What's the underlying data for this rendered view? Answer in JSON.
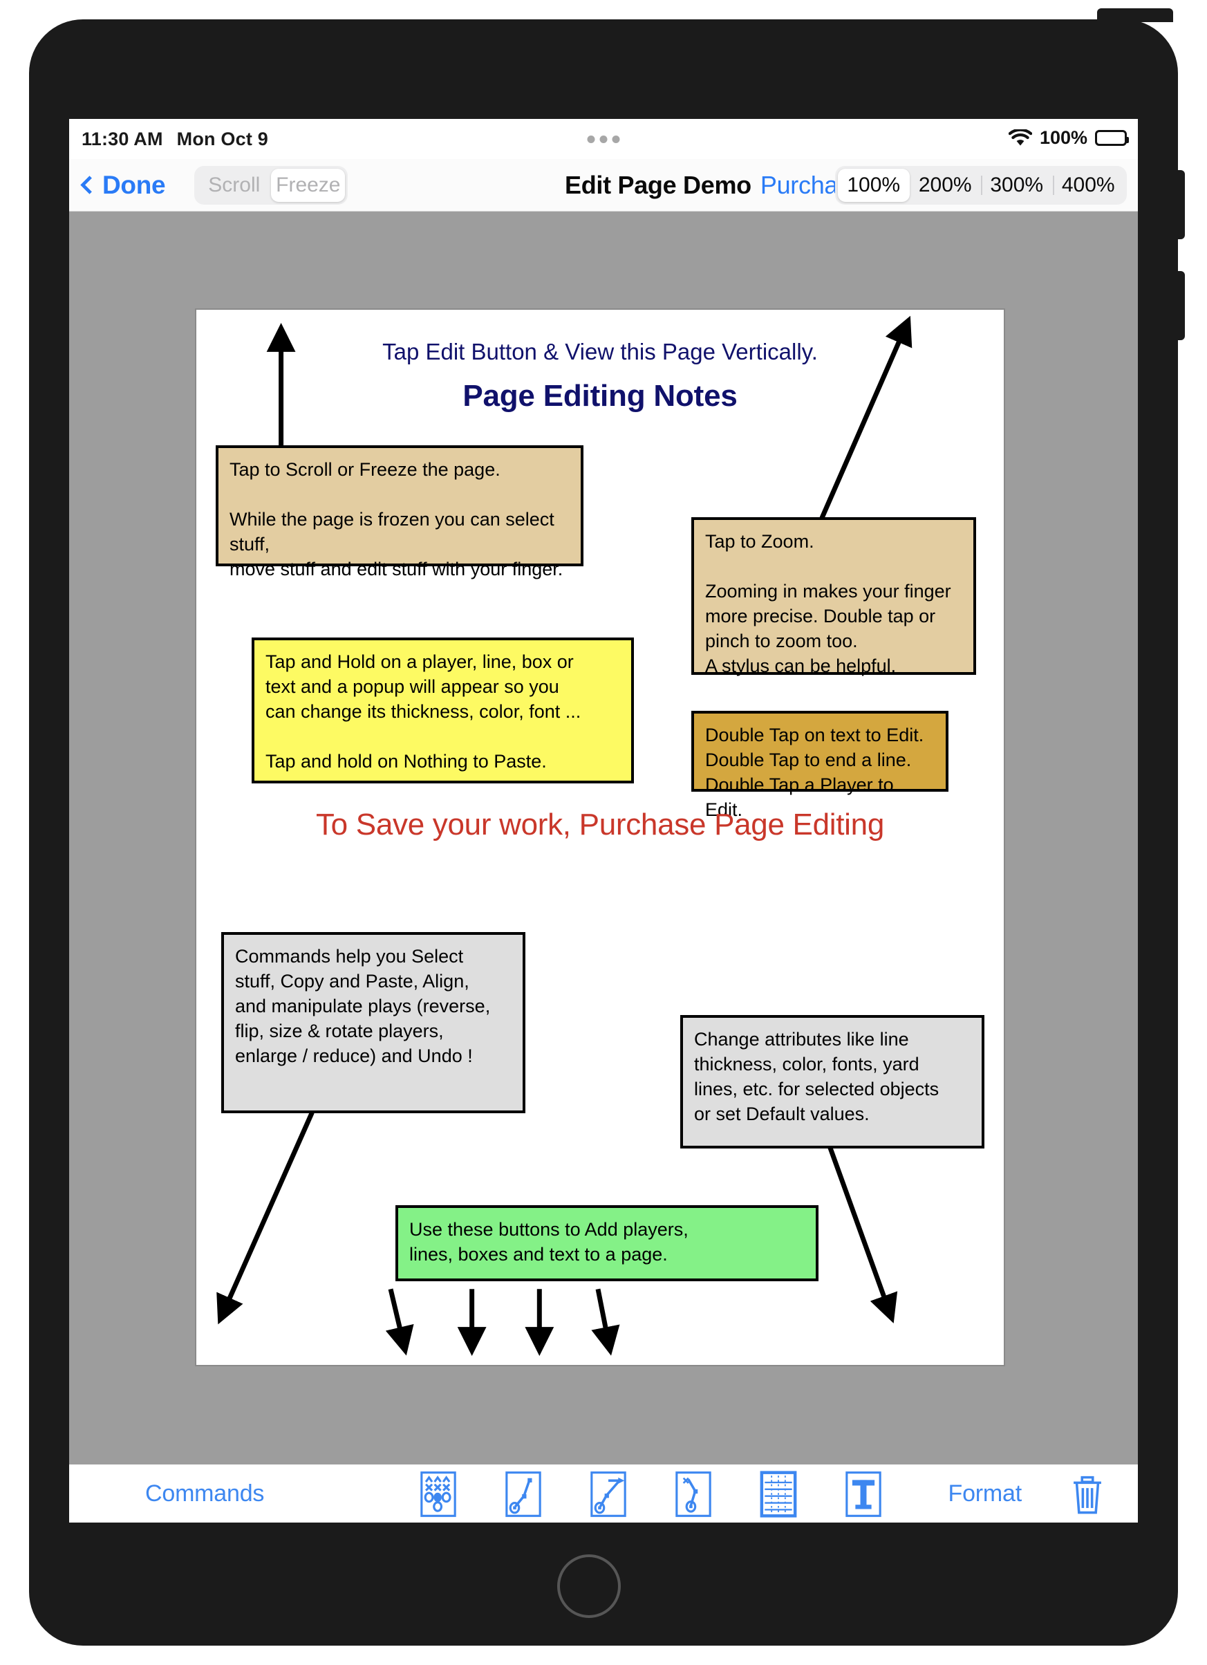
{
  "status_bar": {
    "time": "11:30 AM",
    "date": "Mon Oct 9",
    "wifi_icon": "wifi-icon",
    "battery_percent": "100%",
    "battery_icon": "battery-full-icon",
    "dots_icon": "multitask-dots-icon"
  },
  "nav_bar": {
    "back_icon": "chevron-left-icon",
    "back_label": "Done",
    "mode_segmented": {
      "options": [
        "Scroll",
        "Freeze"
      ],
      "selected": "Freeze"
    },
    "title": "Edit Page Demo",
    "purchase_link": "Purchase",
    "zoom_segmented": {
      "options": [
        "100%",
        "200%",
        "300%",
        "400%"
      ],
      "selected": "100%"
    }
  },
  "page": {
    "subtitle": "Tap Edit Button & View this Page Vertically.",
    "title": "Page Editing Notes",
    "red_callout": "To Save your work, Purchase Page Editing",
    "notes": {
      "scroll_freeze": "Tap to Scroll or Freeze the page.\n\nWhile the page is frozen you can select stuff,\nmove stuff and edit stuff with your finger.",
      "zoom": "Tap to Zoom.\n\nZooming in makes your finger\nmore precise.  Double tap or\npinch to zoom too.\nA stylus can be helpful.",
      "tap_hold": "Tap and Hold on a player, line, box or\ntext and a popup will appear so you\ncan change its thickness, color, font ...\n\nTap and hold on Nothing to Paste.",
      "double_tap": "Double Tap on text to Edit.\nDouble Tap to end a line.\nDouble Tap a Player to Edit.",
      "commands": "Commands help you Select\nstuff, Copy and Paste, Align,\nand manipulate plays (reverse,\nflip, size & rotate players,\nenlarge / reduce) and Undo !",
      "attributes": "Change attributes like line\nthickness, color, fonts, yard\nlines, etc. for selected objects\n or set Default values.",
      "add_buttons": "Use these buttons to Add players,\nlines, boxes and text to a page."
    }
  },
  "toolbar": {
    "commands_label": "Commands",
    "format_label": "Format",
    "icons": [
      "add-players-formation-icon",
      "add-route-line-icon",
      "add-arrow-line-icon",
      "add-block-line-icon",
      "add-box-grid-icon",
      "add-text-icon"
    ],
    "trash_icon": "trash-icon"
  },
  "colors": {
    "accent_blue": "#2a7bf6",
    "toolbar_blue": "#3d87f0",
    "heading_navy": "#10116b",
    "red": "#c9372a",
    "tan": "#e3cda1",
    "gold": "#d4a73f",
    "yellow": "#fdfa63",
    "gray_note": "#dedede",
    "green": "#84f187",
    "canvas_gray": "#9d9d9d"
  }
}
